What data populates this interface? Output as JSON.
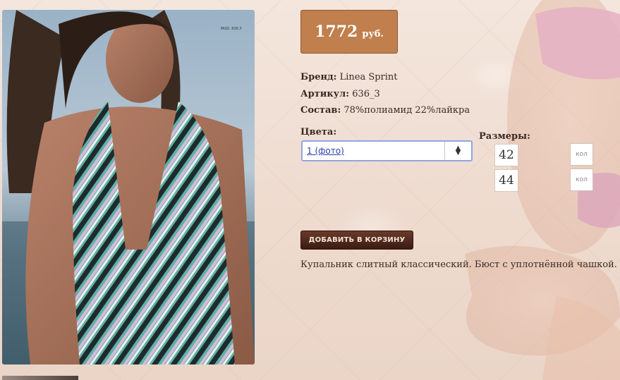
{
  "price": {
    "value": "1772",
    "currency": "руб."
  },
  "product": {
    "brand_label": "Бренд:",
    "brand": "Linea Sprint",
    "article_label": "Артикул:",
    "article": "636_3",
    "composition_label": "Состав:",
    "composition": "78%полиамид 22%лайкра",
    "photo_caption": "MOD. 636.3"
  },
  "colors": {
    "label": "Цвета:",
    "selected": "1 (фото)"
  },
  "sizes": {
    "label": "Размеры:",
    "items": [
      {
        "size": "42",
        "qty_placeholder": "кол"
      },
      {
        "size": "44",
        "qty_placeholder": "кол"
      }
    ]
  },
  "cart_button": "ДОБАВИТЬ В КОРЗИНУ",
  "description": "Купальник слитный классический. Бюст с уплотнённой чашкой."
}
